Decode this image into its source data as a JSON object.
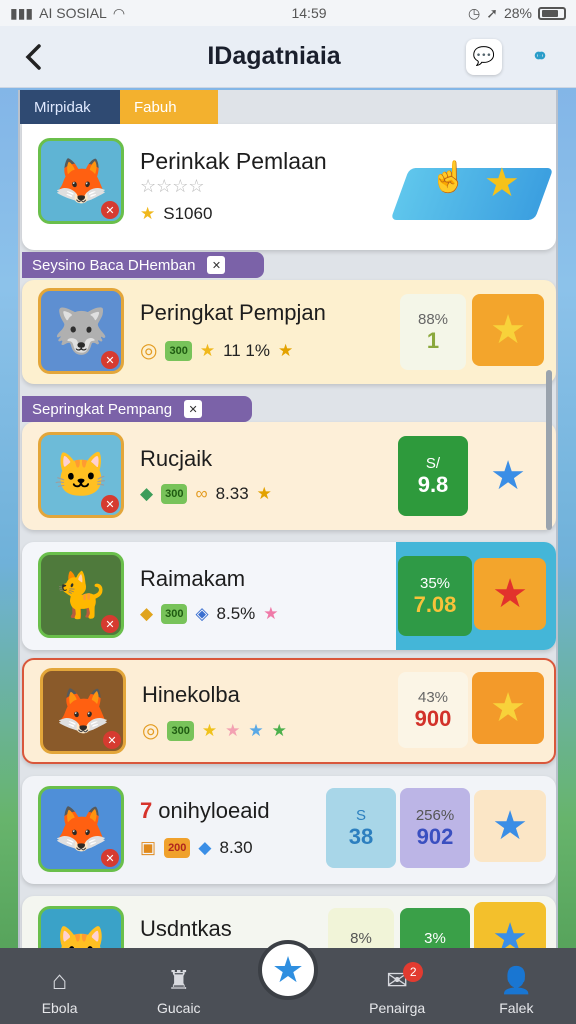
{
  "status": {
    "carrier": "AI SOSIAL",
    "time": "14:59",
    "battery": "28%"
  },
  "header": {
    "title": "IDagatniaia"
  },
  "tabs": [
    {
      "label": "Mirpidak"
    },
    {
      "label": "Fabuh"
    }
  ],
  "sections": [
    {
      "label": "Seysino Baca DHemban",
      "close": "✕"
    },
    {
      "label": "Sepringkat Pempang",
      "close": "✕"
    }
  ],
  "cards": [
    {
      "name": "Perinkak Pemlaan",
      "stars_text": "☆☆☆☆",
      "points": "S1060"
    },
    {
      "name": "Peringkat Pempjan",
      "stat1": "300",
      "stat2": "11 1%",
      "score_top": "88%",
      "score_val": "1"
    },
    {
      "name": "Rucjaik",
      "stat1": "300",
      "stat2": "8.33",
      "score_top": "S/",
      "score_val": "9.8"
    },
    {
      "name": "Raimakam",
      "stat1": "300",
      "stat2": "8.5%",
      "score_top": "35%",
      "score_val": "7.08"
    },
    {
      "name": "Hinekolba",
      "stat1": "300",
      "score_top": "43%",
      "score_val": "900"
    },
    {
      "name": "onihyloeaid",
      "rank": "7",
      "stat1": "200",
      "stat2": "8.30",
      "score1_top": "S",
      "score1_val": "38",
      "score2_top": "256%",
      "score2_val": "902"
    },
    {
      "name": "Usdntkas",
      "score1_top": "8%",
      "score2_top": "3%"
    }
  ],
  "nav": [
    {
      "label": "Ebola",
      "icon": "home-icon"
    },
    {
      "label": "Gucaic",
      "icon": "trophy-icon"
    },
    {
      "label": "Penairga",
      "icon": "message-icon",
      "badge": "2"
    },
    {
      "label": "Falek",
      "icon": "profile-icon"
    }
  ]
}
